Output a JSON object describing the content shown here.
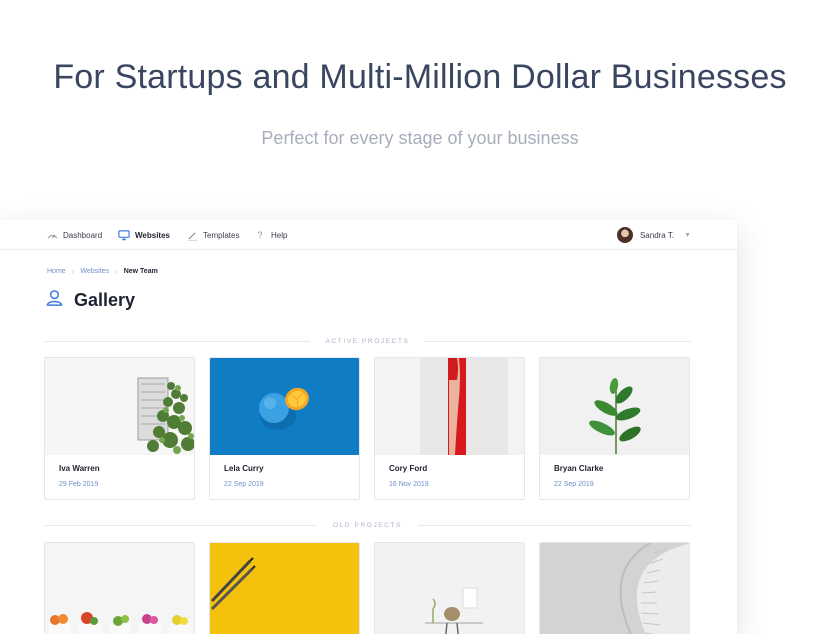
{
  "hero": {
    "title": "For Startups and Multi-Million Dollar Businesses",
    "subtitle": "Perfect for every stage of your business"
  },
  "nav": {
    "items": [
      {
        "label": "Dashboard",
        "icon": "dashboard-icon"
      },
      {
        "label": "Websites",
        "icon": "monitor-icon",
        "active": true
      },
      {
        "label": "Templates",
        "icon": "pencil-icon"
      },
      {
        "label": "Help",
        "icon": "question-icon"
      }
    ],
    "user": {
      "name": "Sandra T."
    }
  },
  "breadcrumb": [
    "Home",
    "Websites",
    "New Team"
  ],
  "page": {
    "title": "Gallery",
    "icon": "user-icon"
  },
  "sections": {
    "active_label": "ACTIVE PROJECTS",
    "old_label": "OLD PROJECTS"
  },
  "active_projects": [
    {
      "name": "Iva Warren",
      "date": "29 Feb 2019"
    },
    {
      "name": "Lela Curry",
      "date": "22 Sep 2019"
    },
    {
      "name": "Cory Ford",
      "date": "16 Nov 2019"
    },
    {
      "name": "Bryan Clarke",
      "date": "22 Sep 2019"
    }
  ],
  "colors": {
    "accent": "#3d7fe0",
    "link": "#6f8fc7",
    "hero_title": "#3a4660",
    "hero_subtitle": "#a7adbb"
  }
}
